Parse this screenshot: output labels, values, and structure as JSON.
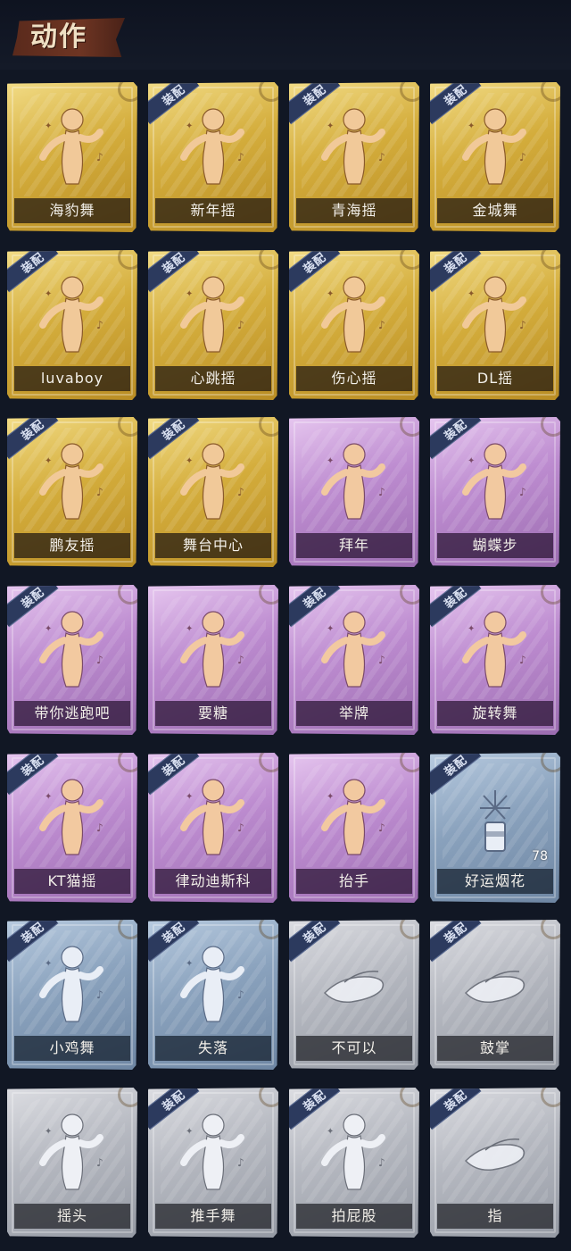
{
  "section_title": "动作",
  "equip_label": "装配",
  "emotes": [
    {
      "label": "海豹舞",
      "rarity": "gold",
      "equipped": false,
      "icon": "dance-pose-icon"
    },
    {
      "label": "新年摇",
      "rarity": "gold",
      "equipped": true,
      "icon": "dance-pose-icon"
    },
    {
      "label": "青海摇",
      "rarity": "gold",
      "equipped": true,
      "icon": "dance-pose-icon"
    },
    {
      "label": "金城舞",
      "rarity": "gold",
      "equipped": true,
      "icon": "dance-pose-icon"
    },
    {
      "label": "luvaboy",
      "rarity": "gold",
      "equipped": true,
      "icon": "dance-pose-icon"
    },
    {
      "label": "心跳摇",
      "rarity": "gold",
      "equipped": true,
      "icon": "dance-pose-icon"
    },
    {
      "label": "伤心摇",
      "rarity": "gold",
      "equipped": true,
      "icon": "heart-hands-pose-icon"
    },
    {
      "label": "DL摇",
      "rarity": "gold",
      "equipped": true,
      "icon": "dance-pose-icon"
    },
    {
      "label": "鹏友摇",
      "rarity": "gold",
      "equipped": true,
      "icon": "dance-pose-icon"
    },
    {
      "label": "舞台中心",
      "rarity": "gold",
      "equipped": true,
      "icon": "dance-pose-icon"
    },
    {
      "label": "拜年",
      "rarity": "purple",
      "equipped": false,
      "icon": "bow-pose-icon"
    },
    {
      "label": "蝴蝶步",
      "rarity": "purple",
      "equipped": true,
      "icon": "dance-pose-icon"
    },
    {
      "label": "带你逃跑吧",
      "rarity": "purple",
      "equipped": true,
      "icon": "point-pose-icon"
    },
    {
      "label": "要糖",
      "rarity": "purple",
      "equipped": false,
      "icon": "reach-pose-icon"
    },
    {
      "label": "举牌",
      "rarity": "purple",
      "equipped": true,
      "icon": "sign-pose-icon"
    },
    {
      "label": "旋转舞",
      "rarity": "purple",
      "equipped": true,
      "icon": "spin-pose-icon"
    },
    {
      "label": "KT猫摇",
      "rarity": "purple",
      "equipped": true,
      "icon": "dance-pose-icon"
    },
    {
      "label": "律动迪斯科",
      "rarity": "purple",
      "equipped": true,
      "icon": "disco-pose-icon"
    },
    {
      "label": "抬手",
      "rarity": "purple",
      "equipped": false,
      "icon": "raise-hand-pose-icon"
    },
    {
      "label": "好运烟花",
      "rarity": "blue",
      "equipped": true,
      "icon": "firework-icon",
      "count": "78"
    },
    {
      "label": "小鸡舞",
      "rarity": "blue",
      "equipped": true,
      "icon": "chicken-dance-pose-icon"
    },
    {
      "label": "失落",
      "rarity": "blue",
      "equipped": true,
      "icon": "crawl-pose-icon"
    },
    {
      "label": "不可以",
      "rarity": "grey",
      "equipped": true,
      "icon": "finger-wag-icon"
    },
    {
      "label": "鼓掌",
      "rarity": "grey",
      "equipped": true,
      "icon": "clap-hands-icon"
    },
    {
      "label": "摇头",
      "rarity": "grey",
      "equipped": false,
      "icon": "shake-head-pose-icon"
    },
    {
      "label": "推手舞",
      "rarity": "grey",
      "equipped": true,
      "icon": "push-hands-pose-icon"
    },
    {
      "label": "拍屁股",
      "rarity": "grey",
      "equipped": true,
      "icon": "butt-slap-pose-icon"
    },
    {
      "label": "指",
      "rarity": "grey",
      "equipped": true,
      "icon": "point-hand-icon"
    }
  ]
}
